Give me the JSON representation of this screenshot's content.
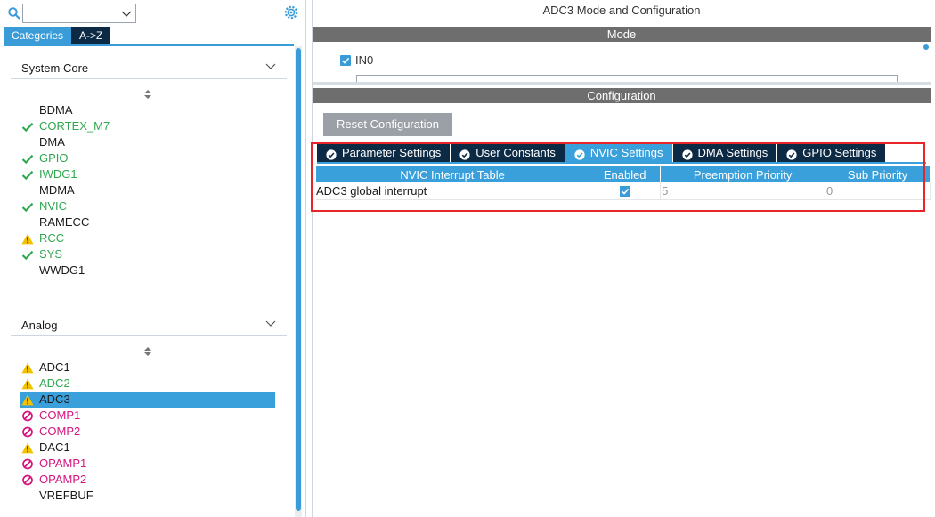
{
  "sidebar": {
    "search": {
      "value": "",
      "placeholder": ""
    },
    "tabs": [
      "Categories",
      "A->Z"
    ],
    "sections": [
      {
        "title": "System Core",
        "items": [
          {
            "label": "BDMA",
            "state": "plain"
          },
          {
            "label": "CORTEX_M7",
            "state": "ok"
          },
          {
            "label": "DMA",
            "state": "plain"
          },
          {
            "label": "GPIO",
            "state": "ok"
          },
          {
            "label": "IWDG1",
            "state": "ok"
          },
          {
            "label": "MDMA",
            "state": "plain"
          },
          {
            "label": "NVIC",
            "state": "ok"
          },
          {
            "label": "RAMECC",
            "state": "plain"
          },
          {
            "label": "RCC",
            "state": "warn-ok"
          },
          {
            "label": "SYS",
            "state": "ok"
          },
          {
            "label": "WWDG1",
            "state": "plain"
          }
        ]
      },
      {
        "title": "Analog",
        "items": [
          {
            "label": "ADC1",
            "state": "warn"
          },
          {
            "label": "ADC2",
            "state": "warn-ok"
          },
          {
            "label": "ADC3",
            "state": "warn",
            "selected": true
          },
          {
            "label": "COMP1",
            "state": "disabled"
          },
          {
            "label": "COMP2",
            "state": "disabled"
          },
          {
            "label": "DAC1",
            "state": "warn"
          },
          {
            "label": "OPAMP1",
            "state": "disabled"
          },
          {
            "label": "OPAMP2",
            "state": "disabled"
          },
          {
            "label": "VREFBUF",
            "state": "plain"
          }
        ]
      }
    ]
  },
  "main": {
    "title": "ADC3 Mode and Configuration",
    "mode_bar": "Mode",
    "mode_option": {
      "label": "IN0",
      "checked": true
    },
    "config_bar": "Configuration",
    "reset_button": "Reset Configuration",
    "tabs": [
      {
        "label": "Parameter Settings",
        "active": false
      },
      {
        "label": "User Constants",
        "active": false
      },
      {
        "label": "NVIC Settings",
        "active": true
      },
      {
        "label": "DMA Settings",
        "active": false
      },
      {
        "label": "GPIO Settings",
        "active": false
      }
    ],
    "nvic_table": {
      "headers": [
        "NVIC Interrupt Table",
        "Enabled",
        "Preemption Priority",
        "Sub Priority"
      ],
      "rows": [
        {
          "name": "ADC3 global interrupt",
          "enabled": true,
          "preemption": "5",
          "sub": "0"
        }
      ]
    }
  },
  "colors": {
    "accent": "#3aa0dc",
    "dark_tab": "#0d2a45",
    "ok": "#2fa84f",
    "warn": "#f2c200",
    "disabled": "#d6157f",
    "highlight_frame": "#e8262a"
  }
}
